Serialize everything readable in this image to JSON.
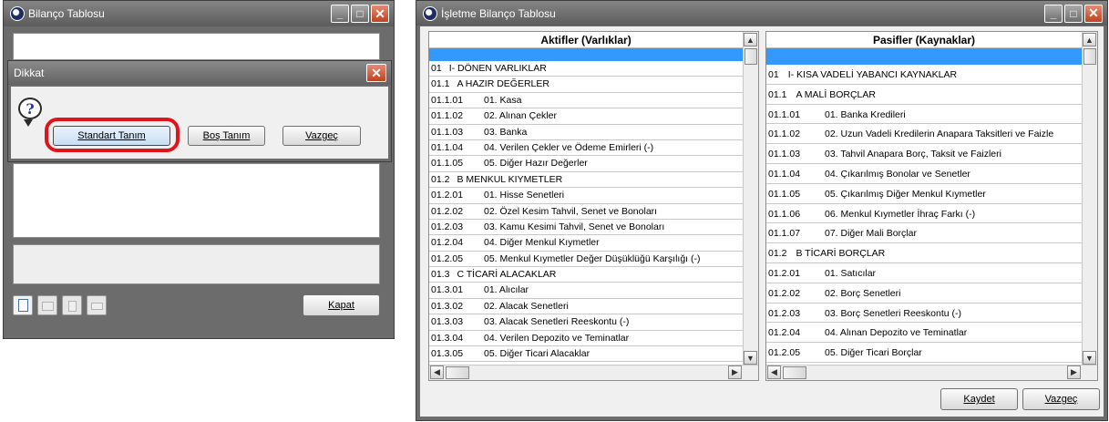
{
  "left_window": {
    "title": "Bilanço Tablosu",
    "close_label": "Kapat"
  },
  "dialog": {
    "title": "Dikkat",
    "icon": "question-icon",
    "buttons": {
      "standard": "Standart Tanım",
      "empty": "Boş Tanım",
      "cancel": "Vazgeç"
    }
  },
  "right_window": {
    "title": "İşletme Bilanço Tablosu",
    "assets": {
      "header": "Aktifler (Varlıklar)",
      "rows": [
        {
          "code": "01",
          "name": "I- DÖNEN VARLIKLAR"
        },
        {
          "code": "01.1",
          "name": "A HAZIR DEĞERLER"
        },
        {
          "code": "01.1.01",
          "name": "01. Kasa"
        },
        {
          "code": "01.1.02",
          "name": "02. Alınan Çekler"
        },
        {
          "code": "01.1.03",
          "name": "03. Banka"
        },
        {
          "code": "01.1.04",
          "name": "04. Verilen Çekler ve Ödeme Emirleri (-)"
        },
        {
          "code": "01.1.05",
          "name": "05. Diğer Hazır Değerler"
        },
        {
          "code": "01.2",
          "name": "B MENKUL KIYMETLER"
        },
        {
          "code": "01.2.01",
          "name": "01. Hisse Senetleri"
        },
        {
          "code": "01.2.02",
          "name": "02. Özel Kesim Tahvil, Senet ve Bonoları"
        },
        {
          "code": "01.2.03",
          "name": "03. Kamu Kesimi Tahvil, Senet ve Bonoları"
        },
        {
          "code": "01.2.04",
          "name": "04. Diğer Menkul Kıymetler"
        },
        {
          "code": "01.2.05",
          "name": "05. Menkul Kıymetler Değer Düşüklüğü Karşılığı (-)"
        },
        {
          "code": "01.3",
          "name": "C TİCARİ ALACAKLAR"
        },
        {
          "code": "01.3.01",
          "name": "01. Alıcılar"
        },
        {
          "code": "01.3.02",
          "name": "02. Alacak Senetleri"
        },
        {
          "code": "01.3.03",
          "name": "03. Alacak Senetleri Reeskontu (-)"
        },
        {
          "code": "01.3.04",
          "name": "04. Verilen Depozito ve Teminatlar"
        },
        {
          "code": "01.3.05",
          "name": "05. Diğer Ticari Alacaklar"
        }
      ]
    },
    "liabilities": {
      "header": "Pasifler (Kaynaklar)",
      "rows": [
        {
          "code": "01",
          "name": "I- KISA VADELİ YABANCI KAYNAKLAR"
        },
        {
          "code": "01.1",
          "name": "A MALİ BORÇLAR"
        },
        {
          "code": "01.1.01",
          "name": "01. Banka Kredileri"
        },
        {
          "code": "01.1.02",
          "name": "02. Uzun Vadeli Kredilerin Anapara Taksitleri ve Faizle"
        },
        {
          "code": "01.1.03",
          "name": "03. Tahvil Anapara Borç, Taksit ve Faizleri"
        },
        {
          "code": "01.1.04",
          "name": "04. Çıkarılmış Bonolar ve Senetler"
        },
        {
          "code": "01.1.05",
          "name": "05. Çıkarılmış Diğer Menkul Kıymetler"
        },
        {
          "code": "01.1.06",
          "name": "06. Menkul Kıymetler İhraç Farkı (-)"
        },
        {
          "code": "01.1.07",
          "name": "07. Diğer Mali Borçlar"
        },
        {
          "code": "01.2",
          "name": "B TİCARİ BORÇLAR"
        },
        {
          "code": "01.2.01",
          "name": "01. Satıcılar"
        },
        {
          "code": "01.2.02",
          "name": "02. Borç Senetleri"
        },
        {
          "code": "01.2.03",
          "name": "03. Borç Senetleri Reeskontu (-)"
        },
        {
          "code": "01.2.04",
          "name": "04. Alınan Depozito ve Teminatlar"
        },
        {
          "code": "01.2.05",
          "name": "05. Diğer Ticari Borçlar"
        }
      ]
    },
    "save_label": "Kaydet",
    "cancel_label": "Vazgeç"
  },
  "colors": {
    "highlight_circle": "#e0141a",
    "selection": "#3399ff"
  }
}
